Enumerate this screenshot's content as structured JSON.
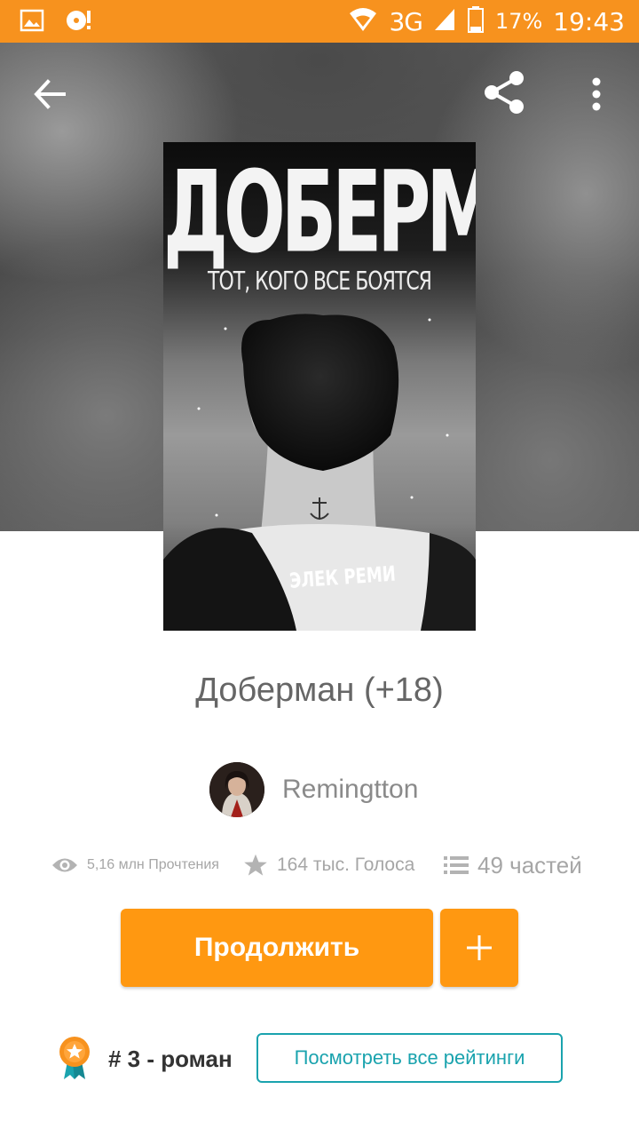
{
  "status_bar": {
    "network": "3G",
    "battery": "17%",
    "time": "19:43"
  },
  "toolbar": {
    "back_icon": "arrow-left-icon",
    "share_icon": "share-icon",
    "more_icon": "more-vertical-icon"
  },
  "cover": {
    "title": "ДОБЕРМАН",
    "subtitle": "ТОТ, КОГО ВСЕ БОЯТСЯ",
    "author": "ЭЛЕК РЕМИ"
  },
  "story": {
    "title": "Доберман (+18)",
    "author": "Remingtton"
  },
  "stats": {
    "reads": "5,16 млн Прочтения",
    "votes": "164 тыс. Голоса",
    "parts": "49 частей"
  },
  "actions": {
    "continue_label": "Продолжить",
    "add_icon": "plus-icon"
  },
  "ranking": {
    "rank_text": "# 3 - роман",
    "view_all_label": "Посмотреть все рейтинги"
  },
  "colors": {
    "accent": "#ff9811",
    "status_bar": "#f7921e",
    "link": "#1aa3ae"
  }
}
